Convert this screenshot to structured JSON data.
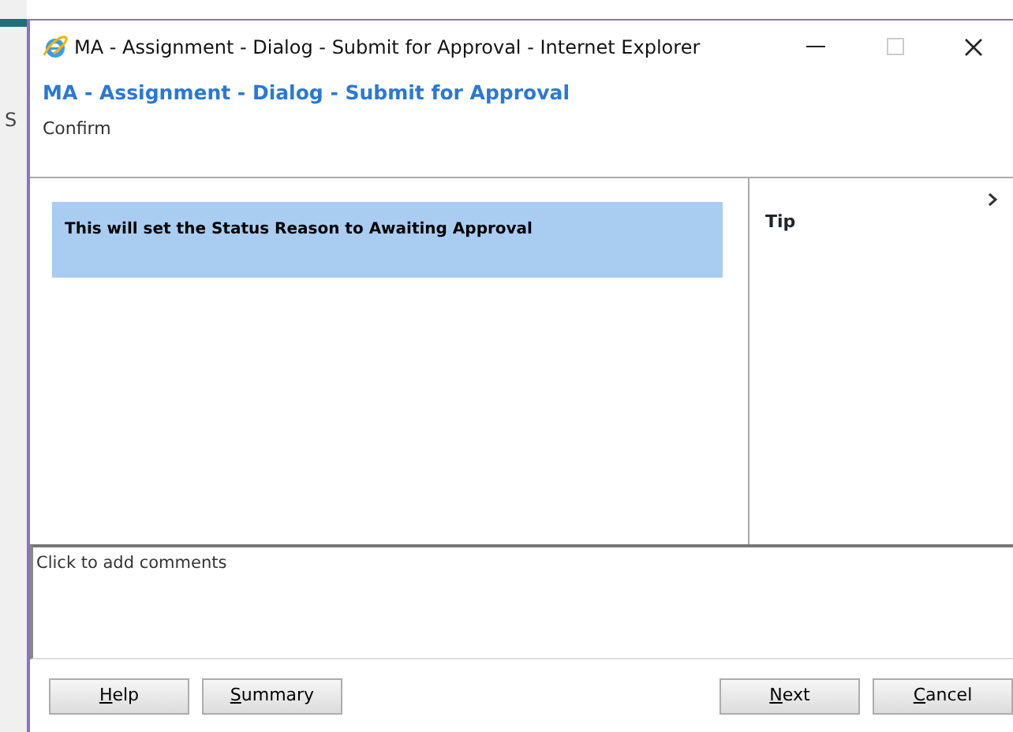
{
  "background": {
    "text": "S"
  },
  "window": {
    "title": "MA - Assignment - Dialog - Submit for Approval - Internet Explorer",
    "maximize_disabled": true
  },
  "dialog": {
    "title": "MA - Assignment - Dialog - Submit for Approval",
    "subtitle": "Confirm"
  },
  "message": "This will set the Status Reason to Awaiting Approval",
  "tip": {
    "label": "Tip",
    "expanded": false
  },
  "comments": {
    "placeholder": "Click to add comments"
  },
  "left_buttons": [
    {
      "label": "Help"
    },
    {
      "label": "Summary"
    }
  ],
  "right_buttons": [
    {
      "label": "Next"
    },
    {
      "label": "Cancel"
    }
  ]
}
